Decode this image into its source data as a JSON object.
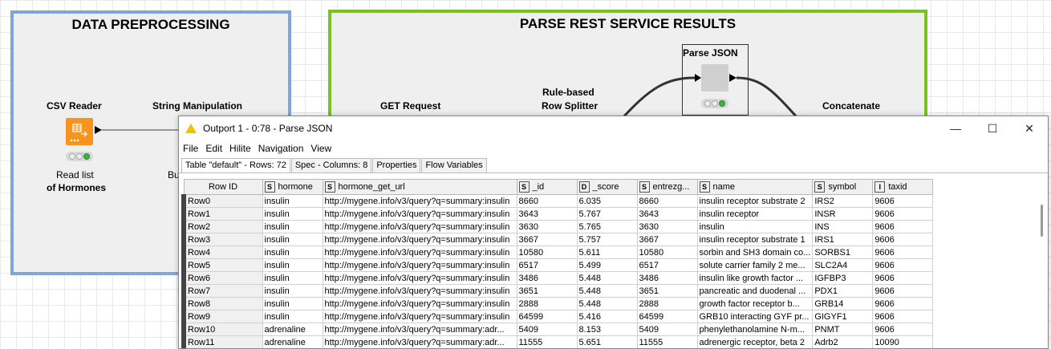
{
  "colors": {
    "preproc_border": "#7ea6d6",
    "parse_border": "#76c41d",
    "node_orange": "#f7941d",
    "node_gray": "#cfcfcf"
  },
  "workflow": {
    "annotations": [
      {
        "title": "DATA PREPROCESSING"
      },
      {
        "title": "PARSE REST SERVICE RESULTS"
      }
    ],
    "nodes": {
      "csv_reader": {
        "label": "CSV Reader",
        "sub1": "Read list",
        "sub2": "of Hormones"
      },
      "string_manipulation": {
        "label": "String Manipulation",
        "sub1": "Bu"
      },
      "get_request": {
        "label": "GET Request"
      },
      "rule_splitter": {
        "label1": "Rule-based",
        "label2": "Row Splitter"
      },
      "parse_json": {
        "label": "Parse JSON"
      },
      "concatenate": {
        "label": "Concatenate"
      }
    }
  },
  "dialog": {
    "title": "Outport 1 - 0:78 - Parse JSON",
    "controls": {
      "minimize": "—",
      "maximize": "☐",
      "close": "✕"
    },
    "menu": [
      "File",
      "Edit",
      "Hilite",
      "Navigation",
      "View"
    ],
    "tabs": [
      "Table \"default\" - Rows: 72",
      "Spec - Columns: 8",
      "Properties",
      "Flow Variables"
    ],
    "columns": [
      {
        "type": "",
        "name": "Row ID"
      },
      {
        "type": "S",
        "name": "hormone"
      },
      {
        "type": "S",
        "name": "hormone_get_url"
      },
      {
        "type": "S",
        "name": "_id"
      },
      {
        "type": "D",
        "name": "_score"
      },
      {
        "type": "S",
        "name": "entrezg..."
      },
      {
        "type": "S",
        "name": "name"
      },
      {
        "type": "S",
        "name": "symbol"
      },
      {
        "type": "I",
        "name": "taxid"
      }
    ],
    "rows": [
      [
        "Row0",
        "insulin",
        "http://mygene.info/v3/query?q=summary:insulin",
        "8660",
        "6.035",
        "8660",
        "insulin receptor substrate 2",
        "IRS2",
        "9606"
      ],
      [
        "Row1",
        "insulin",
        "http://mygene.info/v3/query?q=summary:insulin",
        "3643",
        "5.767",
        "3643",
        "insulin receptor",
        "INSR",
        "9606"
      ],
      [
        "Row2",
        "insulin",
        "http://mygene.info/v3/query?q=summary:insulin",
        "3630",
        "5.765",
        "3630",
        "insulin",
        "INS",
        "9606"
      ],
      [
        "Row3",
        "insulin",
        "http://mygene.info/v3/query?q=summary:insulin",
        "3667",
        "5.757",
        "3667",
        "insulin receptor substrate 1",
        "IRS1",
        "9606"
      ],
      [
        "Row4",
        "insulin",
        "http://mygene.info/v3/query?q=summary:insulin",
        "10580",
        "5.611",
        "10580",
        "sorbin and SH3 domain co...",
        "SORBS1",
        "9606"
      ],
      [
        "Row5",
        "insulin",
        "http://mygene.info/v3/query?q=summary:insulin",
        "6517",
        "5.499",
        "6517",
        "solute carrier family 2 me...",
        "SLC2A4",
        "9606"
      ],
      [
        "Row6",
        "insulin",
        "http://mygene.info/v3/query?q=summary:insulin",
        "3486",
        "5.448",
        "3486",
        "insulin like growth factor ...",
        "IGFBP3",
        "9606"
      ],
      [
        "Row7",
        "insulin",
        "http://mygene.info/v3/query?q=summary:insulin",
        "3651",
        "5.448",
        "3651",
        "pancreatic and duodenal ...",
        "PDX1",
        "9606"
      ],
      [
        "Row8",
        "insulin",
        "http://mygene.info/v3/query?q=summary:insulin",
        "2888",
        "5.448",
        "2888",
        "growth factor receptor b...",
        "GRB14",
        "9606"
      ],
      [
        "Row9",
        "insulin",
        "http://mygene.info/v3/query?q=summary:insulin",
        "64599",
        "5.416",
        "64599",
        "GRB10 interacting GYF pr...",
        "GIGYF1",
        "9606"
      ],
      [
        "Row10",
        "adrenaline",
        "http://mygene.info/v3/query?q=summary:adr...",
        "5409",
        "8.153",
        "5409",
        "phenylethanolamine N-m...",
        "PNMT",
        "9606"
      ],
      [
        "Row11",
        "adrenaline",
        "http://mygene.info/v3/query?q=summary:adr...",
        "11555",
        "5.651",
        "11555",
        "adrenergic receptor, beta 2",
        "Adrb2",
        "10090"
      ]
    ]
  }
}
